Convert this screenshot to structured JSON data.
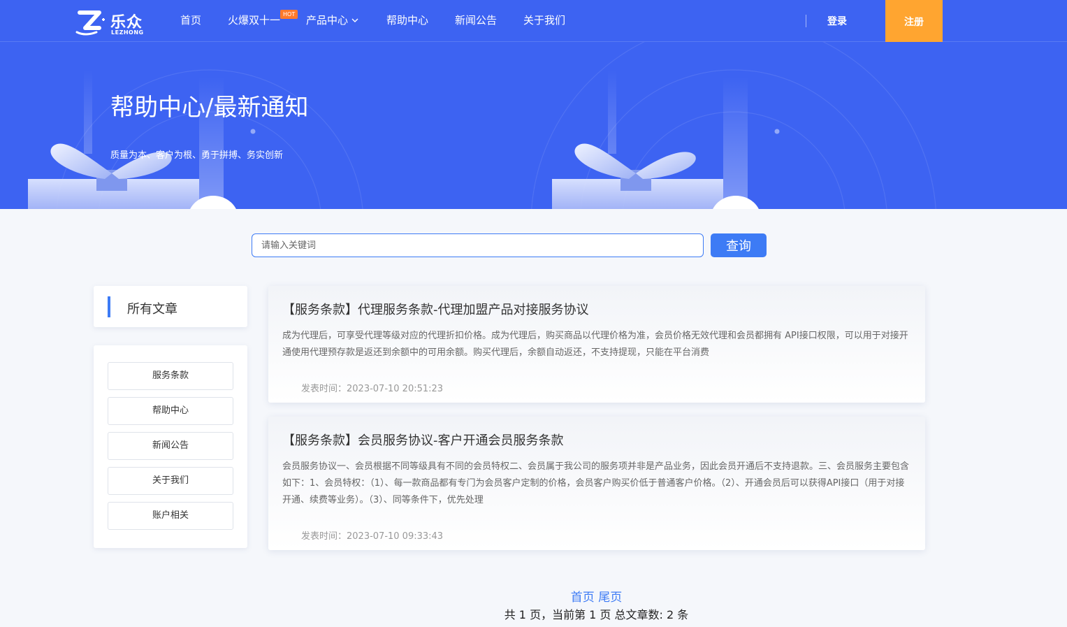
{
  "brand": {
    "name_cn": "乐众",
    "name_en": "LEZHONG"
  },
  "nav": {
    "items": [
      {
        "label": "首页"
      },
      {
        "label": "火爆双十一",
        "badge": "HOT"
      },
      {
        "label": "产品中心",
        "has_dropdown": true
      },
      {
        "label": "帮助中心"
      },
      {
        "label": "新闻公告"
      },
      {
        "label": "关于我们"
      }
    ],
    "login": "登录",
    "register": "注册"
  },
  "banner": {
    "title": "帮助中心/最新通知",
    "subtitle": "质量为本、客户为根、勇于拼搏、务实创新"
  },
  "search": {
    "placeholder": "请输入关键词",
    "button": "查询"
  },
  "sidebar": {
    "heading": "所有文章",
    "items": [
      {
        "label": "服务条款"
      },
      {
        "label": "帮助中心"
      },
      {
        "label": "新闻公告"
      },
      {
        "label": "关于我们"
      },
      {
        "label": "账户相关"
      }
    ]
  },
  "articles": [
    {
      "title": "【服务条款】代理服务条款-代理加盟产品对接服务协议",
      "summary": "成为代理后，可享受代理等级对应的代理折扣价格。成为代理后，购买商品以代理价格为准，会员价格无效代理和会员都拥有 API接口权限，可以用于对接开通使用代理预存款是返还到余额中的可用余额。购买代理后，余额自动返还，不支持提现，只能在平台消费",
      "date": "发表时间：2023-07-10 20:51:23"
    },
    {
      "title": "【服务条款】会员服务协议-客户开通会员服务条款",
      "summary": "会员服务协议一、会员根据不同等级具有不同的会员特权二、会员属于我公司的服务项并非是产品业务，因此会员开通后不支持退款。三、会员服务主要包含如下：1、会员特权：（1）、每一款商品都有专门为会员客户定制的价格，会员客户购买价低于普通客户价格。（2）、开通会员后可以获得API接口（用于对接开通、续费等业务）。（3）、同等条件下，优先处理",
      "date": "发表时间：2023-07-10 09:33:43"
    }
  ],
  "pagination": {
    "first": "首页",
    "last": "尾页",
    "info": "共 1 页，当前第 1 页   总文章数: 2 条"
  },
  "colors": {
    "primary": "#3d63f2",
    "accent": "#3d7bf5",
    "register": "#ffa530",
    "hot": "#ff7a2b"
  }
}
